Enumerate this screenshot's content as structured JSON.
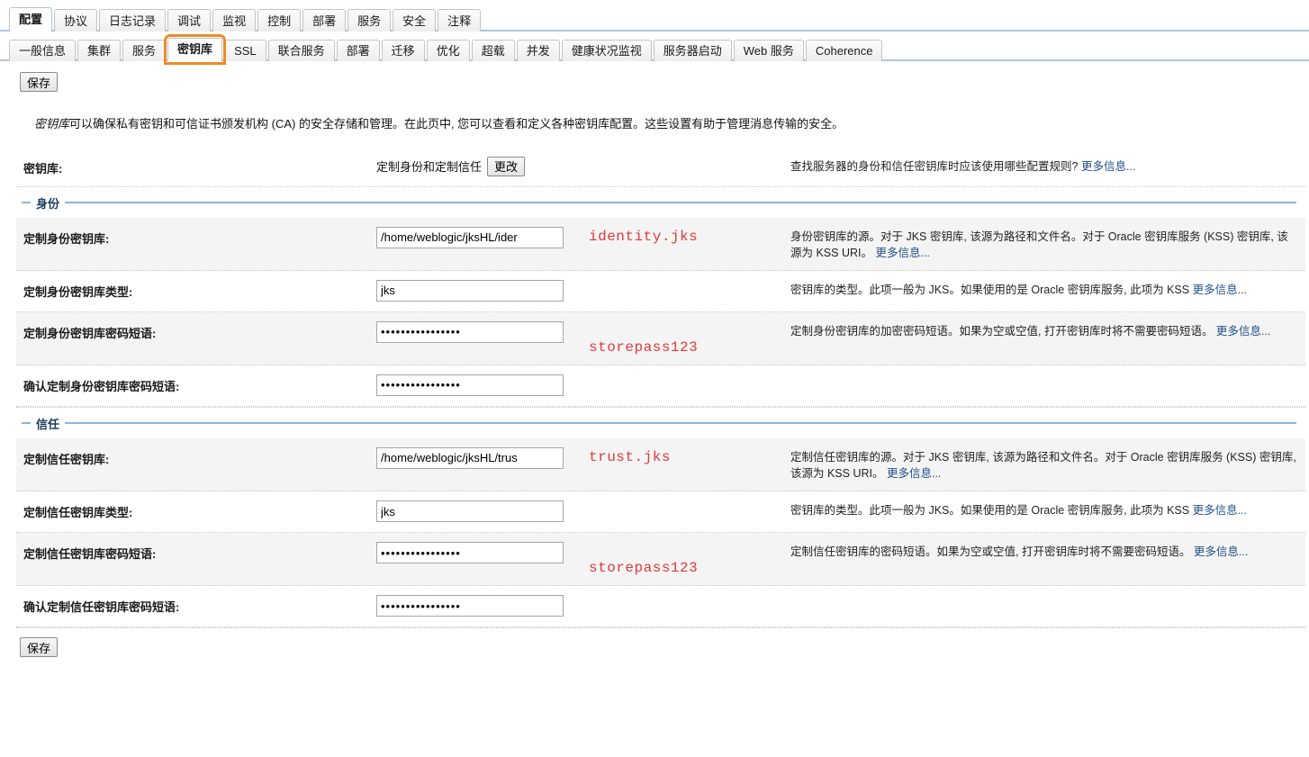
{
  "primary_tabs": [
    {
      "label": "配置",
      "active": true
    },
    {
      "label": "协议",
      "active": false
    },
    {
      "label": "日志记录",
      "active": false
    },
    {
      "label": "调试",
      "active": false
    },
    {
      "label": "监视",
      "active": false
    },
    {
      "label": "控制",
      "active": false
    },
    {
      "label": "部署",
      "active": false
    },
    {
      "label": "服务",
      "active": false
    },
    {
      "label": "安全",
      "active": false
    },
    {
      "label": "注释",
      "active": false
    }
  ],
  "secondary_tabs": [
    {
      "label": "一般信息",
      "active": false,
      "highlight": false
    },
    {
      "label": "集群",
      "active": false,
      "highlight": false
    },
    {
      "label": "服务",
      "active": false,
      "highlight": false
    },
    {
      "label": "密钥库",
      "active": true,
      "highlight": true
    },
    {
      "label": "SSL",
      "active": false,
      "highlight": false
    },
    {
      "label": "联合服务",
      "active": false,
      "highlight": false
    },
    {
      "label": "部署",
      "active": false,
      "highlight": false
    },
    {
      "label": "迁移",
      "active": false,
      "highlight": false
    },
    {
      "label": "优化",
      "active": false,
      "highlight": false
    },
    {
      "label": "超载",
      "active": false,
      "highlight": false
    },
    {
      "label": "并发",
      "active": false,
      "highlight": false
    },
    {
      "label": "健康状况监视",
      "active": false,
      "highlight": false
    },
    {
      "label": "服务器启动",
      "active": false,
      "highlight": false
    },
    {
      "label": "Web 服务",
      "active": false,
      "highlight": false
    },
    {
      "label": "Coherence",
      "active": false,
      "highlight": false
    }
  ],
  "toolbar": {
    "save_top_label": "保存",
    "save_bottom_label": "保存"
  },
  "intro": {
    "emphasis": "密钥库",
    "text": "可以确保私有密钥和可信证书颁发机构 (CA) 的安全存储和管理。在此页中, 您可以查看和定义各种密钥库配置。这些设置有助于管理消息传输的安全。"
  },
  "keystore_row": {
    "label": "密钥库:",
    "value": "定制身份和定制信任",
    "change_button": "更改",
    "help": "查找服务器的身份和信任密钥库时应该使用哪些配置规则?",
    "more": "更多信息..."
  },
  "identity_section": {
    "legend": "身份",
    "rows": [
      {
        "label": "定制身份密钥库:",
        "value": "/home/weblogic/jksHL/ider",
        "type": "text",
        "annotation": "identity.jks",
        "help": "身份密钥库的源。对于 JKS 密钥库, 该源为路径和文件名。对于 Oracle 密钥库服务 (KSS) 密钥库, 该源为 KSS URI。",
        "more": "更多信息..."
      },
      {
        "label": "定制身份密钥库类型:",
        "value": "jks",
        "type": "text",
        "annotation": "",
        "help": "密钥库的类型。此项一般为 JKS。如果使用的是 Oracle 密钥库服务, 此项为 KSS",
        "more": "更多信息..."
      },
      {
        "label": "定制身份密钥库密码短语:",
        "value": "••••••••••••••••",
        "type": "password",
        "annotation": "storepass123",
        "help": "定制身份密钥库的加密密码短语。如果为空或空值, 打开密钥库时将不需要密码短语。",
        "more": "更多信息..."
      },
      {
        "label": "确认定制身份密钥库密码短语:",
        "value": "••••••••••••••••",
        "type": "password",
        "annotation": "",
        "help": "",
        "more": ""
      }
    ]
  },
  "trust_section": {
    "legend": "信任",
    "rows": [
      {
        "label": "定制信任密钥库:",
        "value": "/home/weblogic/jksHL/trus",
        "type": "text",
        "annotation": "trust.jks",
        "help": "定制信任密钥库的源。对于 JKS 密钥库, 该源为路径和文件名。对于 Oracle 密钥库服务 (KSS) 密钥库, 该源为 KSS URI。",
        "more": "更多信息..."
      },
      {
        "label": "定制信任密钥库类型:",
        "value": "jks",
        "type": "text",
        "annotation": "",
        "help": "密钥库的类型。此项一般为 JKS。如果使用的是 Oracle 密钥库服务, 此项为 KSS",
        "more": "更多信息..."
      },
      {
        "label": "定制信任密钥库密码短语:",
        "value": "••••••••••••••••",
        "type": "password",
        "annotation": "storepass123",
        "help": "定制信任密钥库的密码短语。如果为空或空值, 打开密钥库时将不需要密码短语。",
        "more": "更多信息..."
      },
      {
        "label": "确认定制信任密钥库密码短语:",
        "value": "••••••••••••••••",
        "type": "password",
        "annotation": "",
        "help": "",
        "more": ""
      }
    ]
  },
  "colors": {
    "highlight": "#ef8a23",
    "annotation": "#e03a3a",
    "link": "#1f4f87",
    "tab_underline": "#a8c6e2"
  }
}
